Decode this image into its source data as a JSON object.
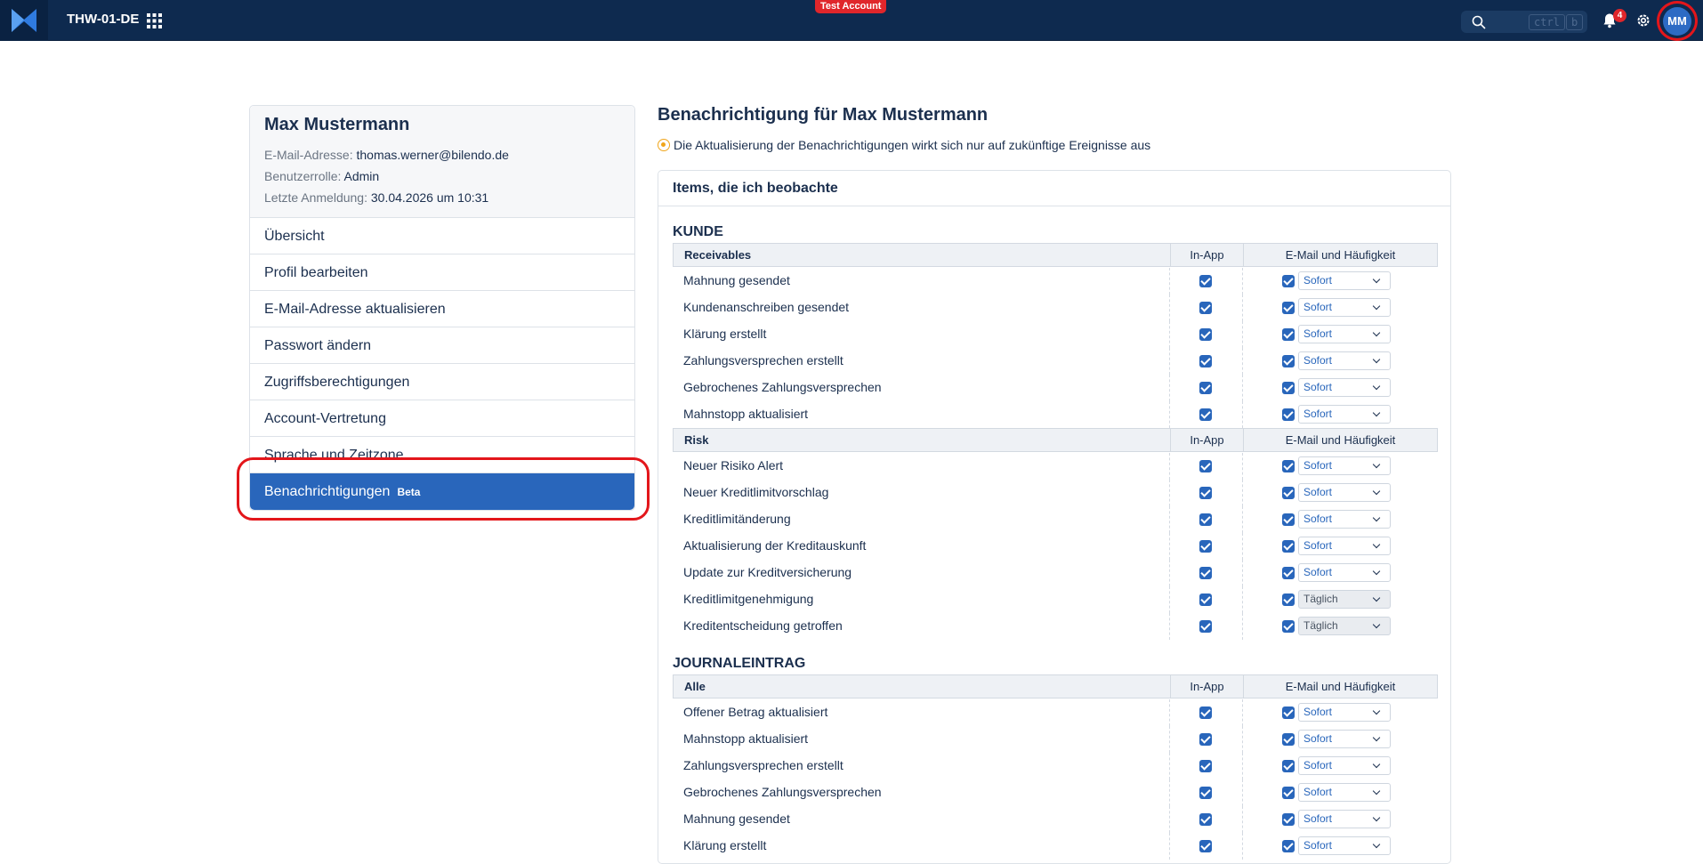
{
  "topbar": {
    "app_title": "THW-01-DE",
    "test_badge": "Test Account",
    "search_kbd_1": "ctrl",
    "search_kbd_2": "b",
    "notification_count": "4",
    "avatar_initials": "MM"
  },
  "profile": {
    "name": "Max Mustermann",
    "email_label": "E-Mail-Adresse:",
    "email_value": "thomas.werner@bilendo.de",
    "role_label": "Benutzerrolle:",
    "role_value": "Admin",
    "login_label": "Letzte Anmeldung:",
    "login_value": "30.04.2026 um 10:31"
  },
  "menu": {
    "items": [
      "Übersicht",
      "Profil bearbeiten",
      "E-Mail-Adresse aktualisieren",
      "Passwort ändern",
      "Zugriffsberechtigungen",
      "Account-Vertretung",
      "Sprache und Zeitzone"
    ],
    "active": "Benachrichtigungen",
    "active_badge": "Beta"
  },
  "main": {
    "title": "Benachrichtigung für Max Mustermann",
    "info": "Die Aktualisierung der Benachrichtigungen wirkt sich nur auf zukünftige Ereignisse aus",
    "card_title": "Items, die ich beobachte"
  },
  "columns": {
    "in_app": "In-App",
    "email": "E-Mail und Häufigkeit"
  },
  "sections": [
    {
      "title": "KUNDE",
      "groups": [
        {
          "name": "Receivables",
          "rows": [
            {
              "label": "Mahnung gesendet",
              "freq": "Sofort"
            },
            {
              "label": "Kundenanschreiben gesendet",
              "freq": "Sofort"
            },
            {
              "label": "Klärung erstellt",
              "freq": "Sofort"
            },
            {
              "label": "Zahlungsversprechen erstellt",
              "freq": "Sofort"
            },
            {
              "label": "Gebrochenes Zahlungsversprechen",
              "freq": "Sofort"
            },
            {
              "label": "Mahnstopp aktualisiert",
              "freq": "Sofort"
            }
          ]
        },
        {
          "name": "Risk",
          "rows": [
            {
              "label": "Neuer Risiko Alert",
              "freq": "Sofort"
            },
            {
              "label": "Neuer Kreditlimitvorschlag",
              "freq": "Sofort"
            },
            {
              "label": "Kreditlimitänderung",
              "freq": "Sofort"
            },
            {
              "label": "Aktualisierung der Kreditauskunft",
              "freq": "Sofort"
            },
            {
              "label": "Update zur Kreditversicherung",
              "freq": "Sofort"
            },
            {
              "label": "Kreditlimitgenehmigung",
              "freq": "Täglich"
            },
            {
              "label": "Kreditentscheidung getroffen",
              "freq": "Täglich"
            }
          ]
        }
      ]
    },
    {
      "title": "JOURNALEINTRAG",
      "groups": [
        {
          "name": "Alle",
          "rows": [
            {
              "label": "Offener Betrag aktualisiert",
              "freq": "Sofort"
            },
            {
              "label": "Mahnstopp aktualisiert",
              "freq": "Sofort"
            },
            {
              "label": "Zahlungsversprechen erstellt",
              "freq": "Sofort"
            },
            {
              "label": "Gebrochenes Zahlungsversprechen",
              "freq": "Sofort"
            },
            {
              "label": "Mahnung gesendet",
              "freq": "Sofort"
            },
            {
              "label": "Klärung erstellt",
              "freq": "Sofort"
            }
          ]
        }
      ]
    }
  ]
}
